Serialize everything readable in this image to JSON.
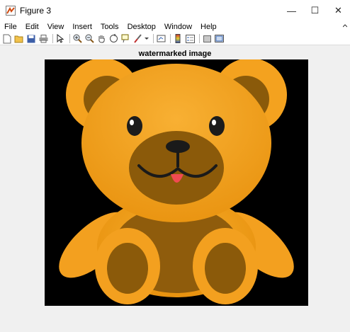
{
  "window": {
    "title": "Figure 3",
    "minimize": "—",
    "maximize": "☐",
    "close": "✕"
  },
  "menu": [
    "File",
    "Edit",
    "View",
    "Insert",
    "Tools",
    "Desktop",
    "Window",
    "Help"
  ],
  "plot": {
    "title": "watermarked image"
  },
  "colors": {
    "bear_body": "#f5a11c",
    "bear_shadow": "#8b5a0a",
    "background": "#000000",
    "tongue": "#f04a52"
  }
}
